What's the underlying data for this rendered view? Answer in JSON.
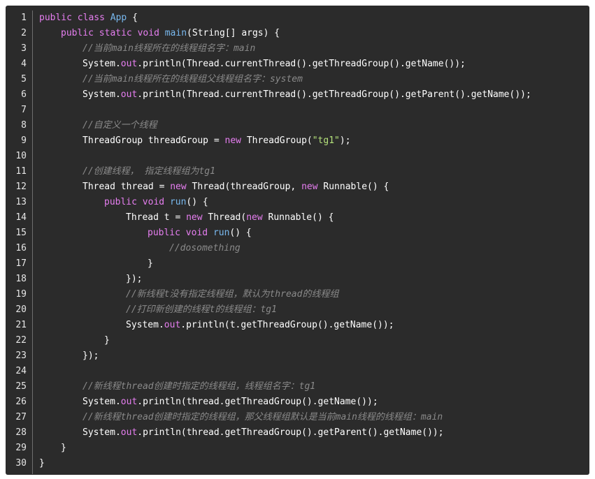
{
  "lines": [
    {
      "n": "1",
      "indent": 0,
      "tokens": [
        [
          "kw",
          "public "
        ],
        [
          "kw",
          "class "
        ],
        [
          "fn",
          "App"
        ],
        [
          "pl",
          " {"
        ]
      ]
    },
    {
      "n": "2",
      "indent": 4,
      "tokens": [
        [
          "kw",
          "public "
        ],
        [
          "kw",
          "static "
        ],
        [
          "kw",
          "void "
        ],
        [
          "fn",
          "main"
        ],
        [
          "pl",
          "(String[] args) {"
        ]
      ]
    },
    {
      "n": "3",
      "indent": 8,
      "tokens": [
        [
          "cm",
          "//当前main线程所在的线程组名字：main"
        ]
      ]
    },
    {
      "n": "4",
      "indent": 8,
      "tokens": [
        [
          "pl",
          "System."
        ],
        [
          "fld",
          "out"
        ],
        [
          "pl",
          ".println(Thread.currentThread().getThreadGroup().getName());"
        ]
      ]
    },
    {
      "n": "5",
      "indent": 8,
      "tokens": [
        [
          "cm",
          "//当前main线程所在的线程组父线程组名字：system"
        ]
      ]
    },
    {
      "n": "6",
      "indent": 8,
      "tokens": [
        [
          "pl",
          "System."
        ],
        [
          "fld",
          "out"
        ],
        [
          "pl",
          ".println(Thread.currentThread().getThreadGroup().getParent().getName());"
        ]
      ]
    },
    {
      "n": "7",
      "indent": 0,
      "tokens": []
    },
    {
      "n": "8",
      "indent": 8,
      "tokens": [
        [
          "cm",
          "//自定义一个线程"
        ]
      ]
    },
    {
      "n": "9",
      "indent": 8,
      "tokens": [
        [
          "pl",
          "ThreadGroup threadGroup = "
        ],
        [
          "kw",
          "new "
        ],
        [
          "pl",
          "ThreadGroup("
        ],
        [
          "str",
          "\"tg1\""
        ],
        [
          "pl",
          ");"
        ]
      ]
    },
    {
      "n": "10",
      "indent": 0,
      "tokens": []
    },
    {
      "n": "11",
      "indent": 8,
      "tokens": [
        [
          "cm",
          "//创建线程， 指定线程组为tg1"
        ]
      ]
    },
    {
      "n": "12",
      "indent": 8,
      "tokens": [
        [
          "pl",
          "Thread thread = "
        ],
        [
          "kw",
          "new "
        ],
        [
          "pl",
          "Thread(threadGroup, "
        ],
        [
          "kw",
          "new "
        ],
        [
          "pl",
          "Runnable() {"
        ]
      ]
    },
    {
      "n": "13",
      "indent": 12,
      "tokens": [
        [
          "kw",
          "public "
        ],
        [
          "kw",
          "void "
        ],
        [
          "fn",
          "run"
        ],
        [
          "pl",
          "() {"
        ]
      ]
    },
    {
      "n": "14",
      "indent": 16,
      "tokens": [
        [
          "pl",
          "Thread t = "
        ],
        [
          "kw",
          "new "
        ],
        [
          "pl",
          "Thread("
        ],
        [
          "kw",
          "new "
        ],
        [
          "pl",
          "Runnable() {"
        ]
      ]
    },
    {
      "n": "15",
      "indent": 20,
      "tokens": [
        [
          "kw",
          "public "
        ],
        [
          "kw",
          "void "
        ],
        [
          "fn",
          "run"
        ],
        [
          "pl",
          "() {"
        ]
      ]
    },
    {
      "n": "16",
      "indent": 24,
      "tokens": [
        [
          "cm",
          "//dosomething"
        ]
      ]
    },
    {
      "n": "17",
      "indent": 20,
      "tokens": [
        [
          "pl",
          "}"
        ]
      ]
    },
    {
      "n": "18",
      "indent": 16,
      "tokens": [
        [
          "pl",
          "});"
        ]
      ]
    },
    {
      "n": "19",
      "indent": 16,
      "tokens": [
        [
          "cm",
          "//新线程t没有指定线程组，默认为thread的线程组"
        ]
      ]
    },
    {
      "n": "20",
      "indent": 16,
      "tokens": [
        [
          "cm",
          "//打印新创建的线程t的线程组：tg1"
        ]
      ]
    },
    {
      "n": "21",
      "indent": 16,
      "tokens": [
        [
          "pl",
          "System."
        ],
        [
          "fld",
          "out"
        ],
        [
          "pl",
          ".println(t.getThreadGroup().getName());"
        ]
      ]
    },
    {
      "n": "22",
      "indent": 12,
      "tokens": [
        [
          "pl",
          "}"
        ]
      ]
    },
    {
      "n": "23",
      "indent": 8,
      "tokens": [
        [
          "pl",
          "});"
        ]
      ]
    },
    {
      "n": "24",
      "indent": 0,
      "tokens": []
    },
    {
      "n": "25",
      "indent": 8,
      "tokens": [
        [
          "cm",
          "//新线程thread创建时指定的线程组，线程组名字：tg1"
        ]
      ]
    },
    {
      "n": "26",
      "indent": 8,
      "tokens": [
        [
          "pl",
          "System."
        ],
        [
          "fld",
          "out"
        ],
        [
          "pl",
          ".println(thread.getThreadGroup().getName());"
        ]
      ]
    },
    {
      "n": "27",
      "indent": 8,
      "tokens": [
        [
          "cm",
          "//新线程thread创建时指定的线程组，那父线程组默认是当前main线程的线程组：main"
        ]
      ]
    },
    {
      "n": "28",
      "indent": 8,
      "tokens": [
        [
          "pl",
          "System."
        ],
        [
          "fld",
          "out"
        ],
        [
          "pl",
          ".println(thread.getThreadGroup().getParent().getName());"
        ]
      ]
    },
    {
      "n": "29",
      "indent": 4,
      "tokens": [
        [
          "pl",
          "}"
        ]
      ]
    },
    {
      "n": "30",
      "indent": 0,
      "tokens": [
        [
          "pl",
          "}"
        ]
      ]
    }
  ]
}
